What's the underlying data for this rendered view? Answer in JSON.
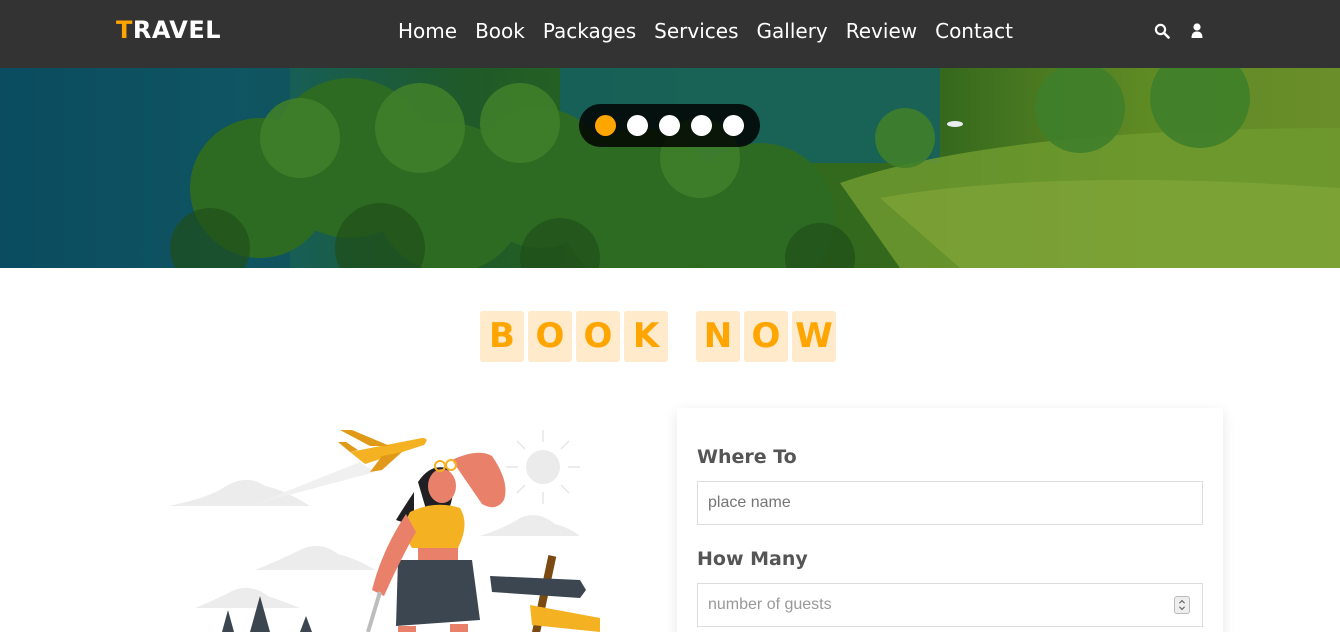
{
  "header": {
    "logo_first": "T",
    "logo_rest": "RAVEL",
    "nav": [
      "Home",
      "Book",
      "Packages",
      "Services",
      "Gallery",
      "Review",
      "Contact"
    ],
    "icons": [
      "search-icon",
      "user-icon"
    ]
  },
  "hero": {
    "slider_count": 5,
    "active_index": 0
  },
  "booking": {
    "heading_letters": [
      "B",
      "O",
      "O",
      "K",
      " ",
      "N",
      "O",
      "W"
    ],
    "where_label": "Where To",
    "where_placeholder": "place name",
    "howmany_label": "How Many",
    "howmany_placeholder": "number of guests"
  },
  "colors": {
    "accent": "#ffa500",
    "header_bg": "#333333",
    "letter_bg": "#ffeacb"
  }
}
